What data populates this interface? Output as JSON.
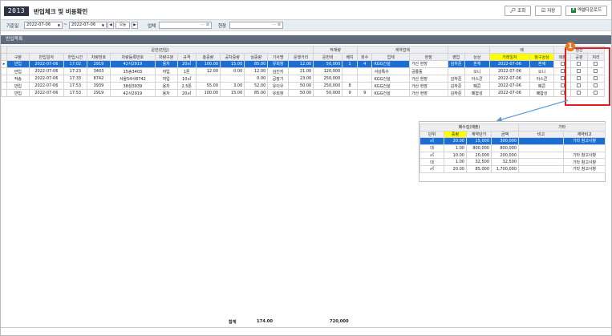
{
  "header": {
    "screen_code": "2013",
    "title": "반입체크 및 비용확인",
    "buttons": {
      "search": "조회",
      "save": "저장",
      "excel": "엑셀다운로드"
    },
    "icons": {
      "search": "search-icon",
      "save": "save-icon",
      "excel": "excel-icon"
    }
  },
  "filter": {
    "date_label": "기준일",
    "date_from": "2022-07-06",
    "tilde": "~",
    "date_to": "2022-07-06",
    "prev": "◀",
    "today": "오늘",
    "next": "▶",
    "company_label": "업체",
    "company_value": "",
    "site_label": "현장",
    "site_value": "",
    "input_tail": "⋯ ⊘"
  },
  "grid": {
    "section_title": "반입목록",
    "groups": {
      "transport": "운반(반입)",
      "unload": "적재량",
      "contract": "계약업체",
      "settle_head": "매",
      "settlement": "정산"
    },
    "columns": [
      "구분",
      "반입일자",
      "반입시간",
      "차량번호",
      "차량등록번호",
      "차량구분",
      "규격",
      "총중량",
      "공차중량",
      "실중량",
      "기사명",
      "운행거리",
      "운반비",
      "배치",
      "회수",
      "업체",
      "현장",
      "영업",
      "상상",
      "거래일자",
      "청구상상",
      "매출",
      "공판",
      "처리"
    ],
    "rows": [
      [
        "반입",
        "2022-07-06",
        "17:02",
        "2919",
        "42사2919",
        "용차",
        "20㎥",
        "100.00",
        "15.00",
        "85.00",
        "유희창",
        "12.00",
        "50,000",
        "1",
        "4",
        "KGG건설",
        "가산 현장",
        "김하준",
        "혼재",
        "2022-07-06",
        "혼재"
      ],
      [
        "반입",
        "2022-07-06",
        "17:23",
        "3403",
        "15송3403",
        "자입",
        "1톤",
        "12.00",
        "0.00",
        "12.00",
        "김진지",
        "21.00",
        "120,000",
        "",
        "",
        "서상톡수",
        "공룡동",
        "",
        "오니",
        "2022-07-06",
        "오니"
      ],
      [
        "작송",
        "2022-07-06",
        "17:33",
        "8742",
        "서울54사8742",
        "자입",
        "10㎥",
        "",
        "",
        "0.00",
        "공장기",
        "23.00",
        "250,000",
        "",
        "",
        "KGG건설",
        "가산 현장",
        "김하준",
        "아스콘",
        "2022-07-06",
        "아스콘"
      ],
      [
        "반입",
        "2022-07-06",
        "17:53",
        "3939",
        "38삼3939",
        "용차",
        "2.5톤",
        "55.00",
        "3.00",
        "52.00",
        "유이우",
        "50.00",
        "250,000",
        "8",
        "",
        "KGG건설",
        "가산 현장",
        "김하준",
        "폐콘",
        "2022-07-06",
        "폐콘"
      ],
      [
        "반입",
        "2022-07-06",
        "17:53",
        "2919",
        "42사2919",
        "용차",
        "20㎥",
        "100.00",
        "15.00",
        "85.00",
        "유희창",
        "50.00",
        "50,000",
        "9",
        "9",
        "KGG건설",
        "가산 현장",
        "김하준",
        "폐합성",
        "2022-07-06",
        "폐합성"
      ]
    ],
    "current_row_marker": "▸",
    "totals": {
      "label": "합계",
      "weight": "174.00",
      "amount": "720,000"
    }
  },
  "annotation": {
    "badge": "1"
  },
  "popup": {
    "groups": {
      "sub": "폐수집(매출)",
      "etc": "기타"
    },
    "columns": [
      "단위",
      "중량",
      "계약단가",
      "금액",
      "비고",
      "계약비고"
    ],
    "rows": [
      [
        "㎥",
        "20.00",
        "15,000",
        "300,000",
        "",
        "기타 참고사항"
      ],
      [
        "대",
        "1.00",
        "800,000",
        "800,000",
        "",
        ""
      ],
      [
        "㎥",
        "10.00",
        "20,000",
        "200,000",
        "",
        "기타 참고사항"
      ],
      [
        "대",
        "1.00",
        "32,500",
        "32,500",
        "",
        "기타 참고사항"
      ],
      [
        "㎥",
        "20.00",
        "85,000",
        "1,700,000",
        "",
        "기타 참고사항"
      ]
    ]
  }
}
